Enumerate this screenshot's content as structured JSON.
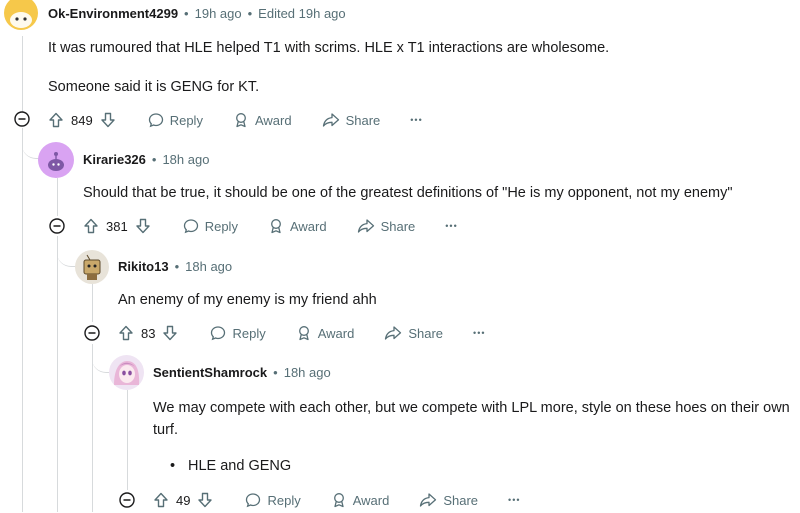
{
  "comments": [
    {
      "author": "Ok-Environment4299",
      "age": "19h ago",
      "edited": "Edited 19h ago",
      "paragraphs": [
        "It was rumoured that HLE helped T1 with scrims. HLE x T1 interactions are wholesome.",
        "Someone said it is GENG for KT."
      ],
      "score": "849"
    },
    {
      "author": "Kirarie326",
      "age": "18h ago",
      "paragraphs": [
        "Should that be true, it should be one of the greatest definitions of \"He is my opponent, not my enemy\""
      ],
      "score": "381"
    },
    {
      "author": "Rikito13",
      "age": "18h ago",
      "paragraphs": [
        "An enemy of my enemy is my friend ahh"
      ],
      "score": "83"
    },
    {
      "author": "SentientShamrock",
      "age": "18h ago",
      "paragraphs": [
        "We may compete with each other, but we compete with LPL more, style on these hoes on their own turf."
      ],
      "bullets": [
        "HLE and GENG"
      ],
      "score": "49"
    }
  ],
  "labels": {
    "dot": "•",
    "reply": "Reply",
    "award": "Award",
    "share": "Share",
    "more": "•••"
  },
  "colors": {
    "meta": "#576f76",
    "thread_line": "#d7dadc",
    "avatar1": "#f6c84a",
    "avatar2": "#d9a3f2"
  }
}
